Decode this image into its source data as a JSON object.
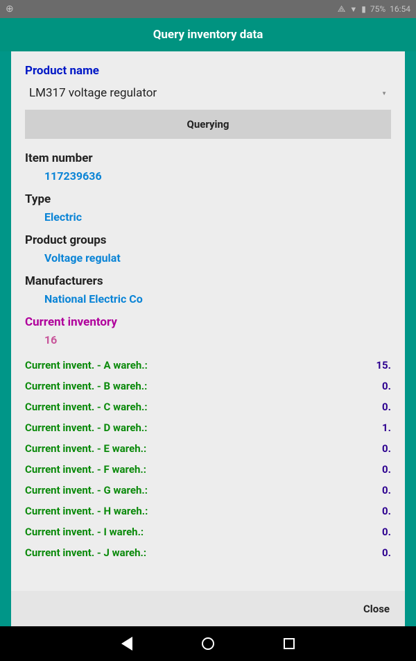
{
  "statusbar": {
    "battery": "75%",
    "time": "16:54"
  },
  "header": {
    "title": "Query inventory data"
  },
  "form": {
    "product_name_label": "Product name",
    "product_name_value": "LM317 voltage regulator",
    "query_button": "Querying"
  },
  "details": {
    "item_number_label": "Item number",
    "item_number_value": "117239636",
    "type_label": "Type",
    "type_value": "Electric",
    "product_groups_label": "Product groups",
    "product_groups_value": "Voltage regulat",
    "manufacturers_label": "Manufacturers",
    "manufacturers_value": "National Electric Co",
    "current_inventory_label": "Current inventory",
    "current_inventory_value": "16"
  },
  "warehouses": [
    {
      "label": "Current invent.  -  A wareh.:",
      "value": "15."
    },
    {
      "label": "Current invent.  -  B wareh.:",
      "value": "0."
    },
    {
      "label": "Current invent.  -  C wareh.:",
      "value": "0."
    },
    {
      "label": "Current invent.  -  D wareh.:",
      "value": "1."
    },
    {
      "label": "Current invent.  -  E wareh.:",
      "value": "0."
    },
    {
      "label": "Current invent.  -  F wareh.:",
      "value": "0."
    },
    {
      "label": "Current invent.  - G wareh.:",
      "value": "0."
    },
    {
      "label": "Current invent.  - H wareh.:",
      "value": "0."
    },
    {
      "label": "Current invent.  - I wareh.:",
      "value": "0."
    },
    {
      "label": "Current invent.  - J wareh.:",
      "value": "0."
    }
  ],
  "footer": {
    "close": "Close"
  }
}
